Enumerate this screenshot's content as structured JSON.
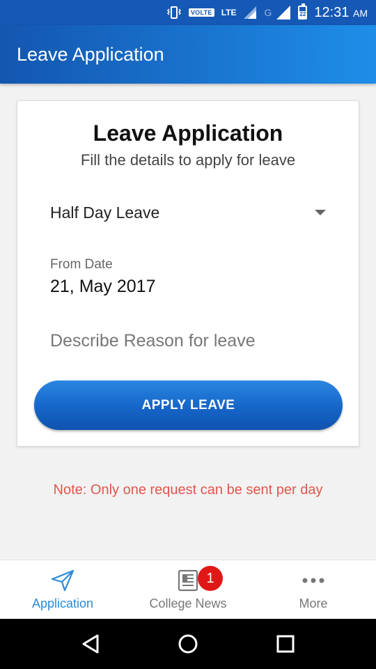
{
  "status_bar": {
    "volte": "VOLTE",
    "network": "LTE",
    "network2": "G",
    "battery": "22",
    "time": "12:31",
    "ampm": "AM"
  },
  "app_bar": {
    "title": "Leave Application"
  },
  "form": {
    "title": "Leave Application",
    "subtitle": "Fill the details to apply for leave",
    "leave_type": "Half Day Leave",
    "from_date_label": "From Date",
    "from_date_value": "21, May 2017",
    "reason_placeholder": "Describe Reason for leave",
    "submit_label": "APPLY LEAVE"
  },
  "note": "Note: Only one request can be sent per day",
  "bottom_nav": {
    "items": [
      {
        "label": "Application",
        "icon": "send-icon",
        "active": true
      },
      {
        "label": "College News",
        "icon": "newspaper-icon",
        "badge": "1"
      },
      {
        "label": "More",
        "icon": "more-dots-icon"
      }
    ]
  },
  "colors": {
    "primary": "#1558b5",
    "accent": "#2a8ad8",
    "note": "#e0574f",
    "badge": "#e11717"
  }
}
